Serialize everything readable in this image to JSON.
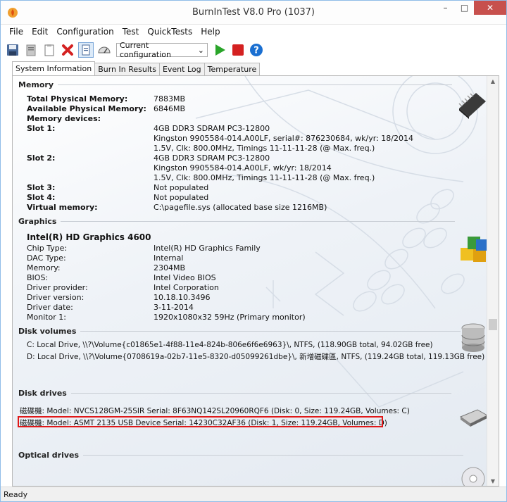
{
  "window": {
    "title": "BurnInTest V8.0 Pro (1037)"
  },
  "menu": [
    "File",
    "Edit",
    "Configuration",
    "Test",
    "QuickTests",
    "Help"
  ],
  "toolbar": {
    "config_select_value": "Current configuration"
  },
  "tabs": [
    "System Information",
    "Burn In Results",
    "Event Log",
    "Temperature"
  ],
  "memory": {
    "title": "Memory",
    "rows": [
      {
        "label": "Total Physical Memory:",
        "value": "7883MB"
      },
      {
        "label": "Available Physical Memory:",
        "value": "6846MB"
      },
      {
        "label": "Memory devices:",
        "value": ""
      }
    ],
    "slot1_label": "Slot 1:",
    "slot1_lines": [
      "4GB DDR3 SDRAM PC3-12800",
      "Kingston 9905584-014.A00LF, serial#: 876230684, wk/yr: 18/2014",
      "1.5V, Clk: 800.0MHz, Timings 11-11-11-28 (@ Max. freq.)"
    ],
    "slot2_label": "Slot 2:",
    "slot2_lines": [
      "4GB DDR3 SDRAM PC3-12800",
      "Kingston 9905584-014.A00LF, wk/yr: 18/2014",
      "1.5V, Clk: 800.0MHz, Timings 11-11-11-28 (@ Max. freq.)"
    ],
    "rows2": [
      {
        "label": "Slot 3:",
        "value": "Not populated"
      },
      {
        "label": "Slot 4:",
        "value": "Not populated"
      },
      {
        "label": "Virtual memory:",
        "value": "C:\\pagefile.sys (allocated base size 1216MB)"
      }
    ]
  },
  "graphics": {
    "title": "Graphics",
    "adapter": "Intel(R) HD Graphics 4600",
    "rows": [
      {
        "label": "Chip Type:",
        "value": "Intel(R) HD Graphics Family"
      },
      {
        "label": "DAC Type:",
        "value": "Internal"
      },
      {
        "label": "Memory:",
        "value": "2304MB"
      },
      {
        "label": "BIOS:",
        "value": "Intel Video BIOS"
      },
      {
        "label": "Driver provider:",
        "value": "Intel Corporation"
      },
      {
        "label": "Driver version:",
        "value": "10.18.10.3496"
      },
      {
        "label": "Driver date:",
        "value": "3-11-2014"
      },
      {
        "label": "Monitor 1:",
        "value": "1920x1080x32 59Hz (Primary monitor)"
      }
    ]
  },
  "disk_volumes": {
    "title": "Disk volumes",
    "lines": [
      "C:  Local Drive, \\\\?\\Volume{c01865e1-4f88-11e4-824b-806e6f6e6963}\\, NTFS, (118.90GB total, 94.02GB free)",
      "D:  Local Drive, \\\\?\\Volume{0708619a-02b7-11e5-8320-d05099261dbe}\\, 新增磁碟區, NTFS, (119.24GB total, 119.13GB free)"
    ]
  },
  "disk_drives": {
    "title": "Disk drives",
    "lines": [
      "磁碟機: Model: NVCS128GM-25SIR Serial: 8F63NQ142SL20960RQF6 (Disk: 0, Size: 119.24GB, Volumes: C)",
      "磁碟機: Model: ASMT 2135 USB Device Serial: 14230C32AF36 (Disk: 1, Size: 119.24GB, Volumes: D)"
    ]
  },
  "optical": {
    "title": "Optical drives"
  },
  "status": {
    "text": "Ready"
  },
  "colors": {
    "highlight": "#e01818",
    "close_button": "#c7504d",
    "play": "#2aa52a",
    "stop": "#d42121",
    "help": "#1a6fd1"
  }
}
